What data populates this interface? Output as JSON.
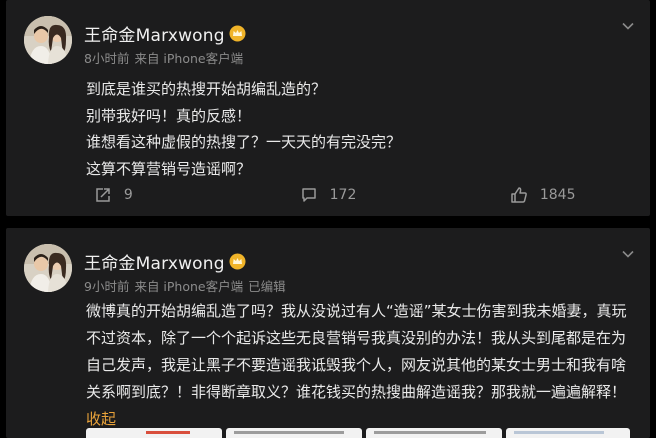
{
  "posts": [
    {
      "username": "王命金Marxwong",
      "time": "8小时前",
      "source": "来自 iPhone客户端",
      "edited": "",
      "lines": [
        "到底是谁买的热搜开始胡编乱造的？",
        "别带我好吗！真的反感！",
        "谁想看这种虚假的热搜了？一天天的有完没完？",
        "这算不算营销号造谣啊？"
      ],
      "actions": {
        "repost": "9",
        "comment": "172",
        "like": "1845"
      }
    },
    {
      "username": "王命金Marxwong",
      "time": "9小时前",
      "source": "来自 iPhone客户端",
      "edited": "已编辑",
      "lines": [
        "微博真的开始胡编乱造了吗？我从没说过有人“造谣”某女士伤害到我未婚妻，真玩",
        "不过资本，除了一个个起诉这些无良营销号我真没别的办法！我从头到尾都是在为",
        "自己发声，我是让黑子不要造谣我诋毁我个人，网友说其他的某女士男士和我有啥",
        "关系啊到底？！非得断章取义？谁花钱买的热搜曲解造谣我？那我就一遍遍解释！"
      ],
      "collapse_label": "收起"
    }
  ],
  "colors": {
    "background": "#000000",
    "card": "#1c1c1d",
    "accent": "#e8a23a",
    "verified_badge": "#f0b429",
    "meta_text": "#8b8b8b"
  },
  "icons": {
    "verified": "crown-badge-icon",
    "more": "chevron-down-icon",
    "repost": "share-icon",
    "comment": "comment-icon",
    "like": "thumbs-up-icon"
  }
}
